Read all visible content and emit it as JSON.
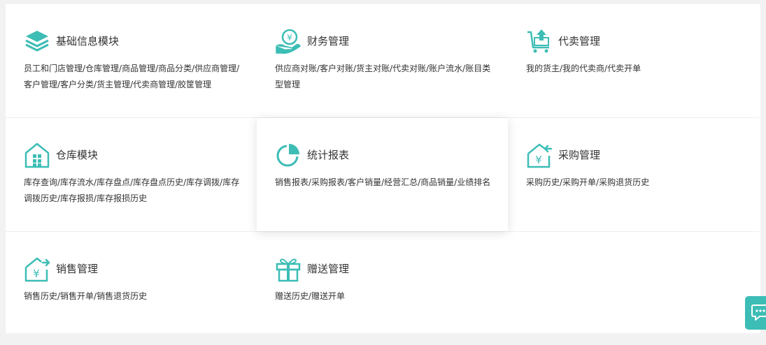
{
  "theme": {
    "accent": "#3cbdb5",
    "text": "#333333"
  },
  "modules": [
    {
      "id": "basic-info",
      "icon": "layers-icon",
      "title": "基础信息模块",
      "desc": "员工和门店管理/仓库管理/商品管理/商品分类/供应商管理/客户管理/客户分类/货主管理/代卖商管理/胶筐管理"
    },
    {
      "id": "finance",
      "icon": "hand-money-icon",
      "title": "财务管理",
      "desc": "供应商对账/客户对账/货主对账/代卖对账/账户流水/账目类型管理"
    },
    {
      "id": "consignment",
      "icon": "cart-upload-icon",
      "title": "代卖管理",
      "desc": "我的货主/我的代卖商/代卖开单"
    },
    {
      "id": "warehouse",
      "icon": "warehouse-icon",
      "title": "仓库模块",
      "desc": "库存查询/库存流水/库存盘点/库存盘点历史/库存调拨/库存调拨历史/库存报损/库存报损历史"
    },
    {
      "id": "reports",
      "icon": "pie-chart-icon",
      "title": "统计报表",
      "desc": "销售报表/采购报表/客户销量/经营汇总/商品销量/业绩排名"
    },
    {
      "id": "purchase",
      "icon": "house-yen-in-icon",
      "title": "采购管理",
      "desc": "采购历史/采购开单/采购退货历史"
    },
    {
      "id": "sales",
      "icon": "house-yen-out-icon",
      "title": "销售管理",
      "desc": "销售历史/销售开单/销售退货历史"
    },
    {
      "id": "gift",
      "icon": "gift-icon",
      "title": "赠送管理",
      "desc": "赠送历史/赠送开单"
    }
  ],
  "chat": {
    "icon": "chat-icon"
  }
}
